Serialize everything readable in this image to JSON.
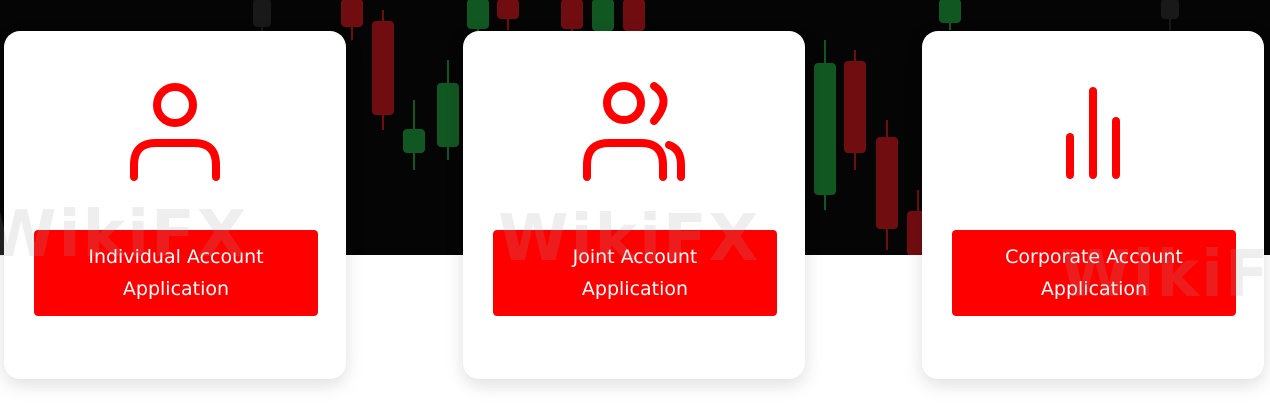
{
  "colors": {
    "accent": "#ff0000",
    "card_background": "#ffffff",
    "hero_background": "#050505"
  },
  "watermark": {
    "text": "WikiFX"
  },
  "cards": [
    {
      "icon": "user-icon",
      "button_line1": "Individual Account",
      "button_line2": "Application"
    },
    {
      "icon": "users-icon",
      "button_line1": "Joint Account",
      "button_line2": "Application"
    },
    {
      "icon": "bar-chart-icon",
      "button_line1": "Corporate Account",
      "button_line2": "Application"
    }
  ]
}
